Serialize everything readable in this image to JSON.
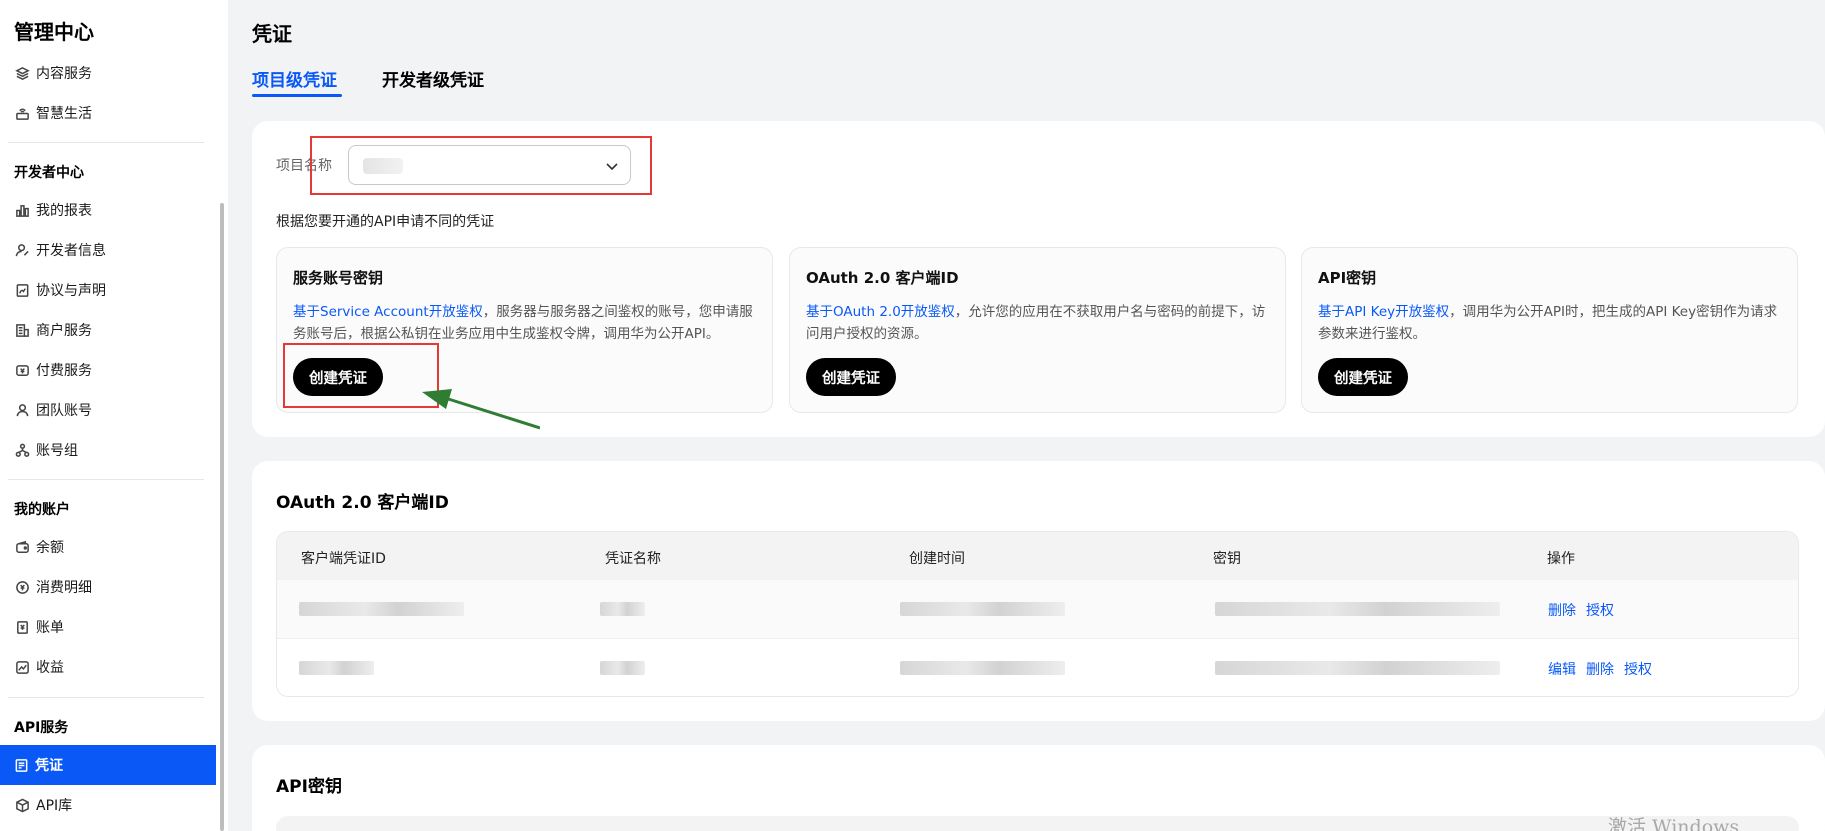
{
  "sidebar": {
    "title": "管理中心",
    "items_top": [
      {
        "label": "内容服务",
        "icon": "layers-icon"
      },
      {
        "label": "智慧生活",
        "icon": "router-icon"
      }
    ],
    "section_dev": "开发者中心",
    "items_dev": [
      {
        "label": "我的报表",
        "icon": "bar-chart-icon"
      },
      {
        "label": "开发者信息",
        "icon": "user-edit-icon"
      },
      {
        "label": "协议与声明",
        "icon": "agreement-icon"
      },
      {
        "label": "商户服务",
        "icon": "merchant-icon"
      },
      {
        "label": "付费服务",
        "icon": "payment-icon"
      },
      {
        "label": "团队账号",
        "icon": "team-icon"
      },
      {
        "label": "账号组",
        "icon": "group-icon"
      }
    ],
    "section_account": "我的账户",
    "items_account": [
      {
        "label": "余额",
        "icon": "wallet-icon"
      },
      {
        "label": "消费明细",
        "icon": "coin-icon"
      },
      {
        "label": "账单",
        "icon": "bill-icon"
      },
      {
        "label": "收益",
        "icon": "trend-icon"
      }
    ],
    "section_api": "API服务",
    "active_item": "凭证",
    "item_api_lib": "API库"
  },
  "main": {
    "title": "凭证",
    "tabs": [
      {
        "label": "项目级凭证",
        "active": true
      },
      {
        "label": "开发者级凭证",
        "active": false
      }
    ],
    "project_label": "项目名称",
    "hint": "根据您要开通的API申请不同的凭证",
    "cred_cards": [
      {
        "title": "服务账号密钥",
        "link": "基于Service Account开放鉴权",
        "desc": "，服务器与服务器之间鉴权的账号，您申请服务账号后，根据公私钥在业务应用中生成鉴权令牌，调用华为公开API。",
        "button": "创建凭证"
      },
      {
        "title": "OAuth 2.0 客户端ID",
        "link": "基于OAuth 2.0开放鉴权",
        "desc": "，允许您的应用在不获取用户名与密码的前提下，访问用户授权的资源。",
        "button": "创建凭证"
      },
      {
        "title": "API密钥",
        "link": "基于API Key开放鉴权",
        "desc": "，调用华为公开API时，把生成的API Key密钥作为请求参数来进行鉴权。",
        "button": "创建凭证"
      }
    ],
    "oauth_section": {
      "title": "OAuth 2.0 客户端ID",
      "columns": [
        "客户端凭证ID",
        "凭证名称",
        "创建时间",
        "密钥",
        "操作"
      ],
      "row1_actions": [
        "删除",
        "授权"
      ],
      "row2_actions": [
        "编辑",
        "删除",
        "授权"
      ]
    },
    "api_key_section_title": "API密钥"
  },
  "watermark": "激活 Windows",
  "colors": {
    "accent": "#0a59f7",
    "annotation_red": "#e53935",
    "annotation_arrow": "#2e7d32"
  }
}
